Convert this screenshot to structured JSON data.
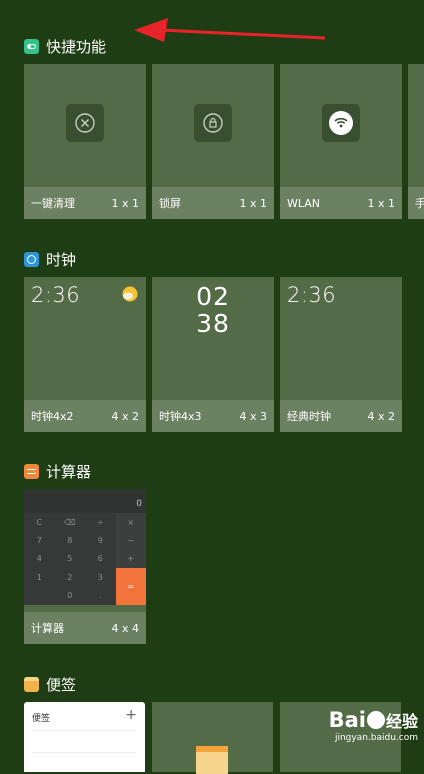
{
  "sections": {
    "quick": {
      "title": "快捷功能",
      "icon": "toggle-icon",
      "color": "#35c289"
    },
    "clock": {
      "title": "时钟",
      "icon": "clock-icon",
      "color": "#2f95d6"
    },
    "calculator": {
      "title": "计算器",
      "icon": "calculator-icon",
      "color": "#f08a3a"
    },
    "notes": {
      "title": "便签",
      "icon": "notes-icon",
      "color": "#f3b24a"
    }
  },
  "quick_tiles": [
    {
      "label": "一键清理",
      "size": "1 x 1",
      "icon": "close-circle-icon"
    },
    {
      "label": "锁屏",
      "size": "1 x 1",
      "icon": "lock-icon"
    },
    {
      "label": "WLAN",
      "size": "1 x 1",
      "icon": "wifi-icon"
    },
    {
      "label": "手",
      "size": "",
      "icon": ""
    }
  ],
  "clock_tiles": [
    {
      "label": "时钟4x2",
      "size": "4 x 2",
      "time": "2:36",
      "icon": "weather-sun-cloud-icon"
    },
    {
      "label": "时钟4x3",
      "size": "4 x 3",
      "hour": "02",
      "minute": "38"
    },
    {
      "label": "经典时钟",
      "size": "4 x 2",
      "time": "2:36"
    }
  ],
  "calculator_tile": {
    "label": "计算器",
    "size": "4 x 4",
    "display": "0",
    "keys": [
      "C",
      "⌫",
      "÷",
      "×",
      "7",
      "8",
      "9",
      "−",
      "4",
      "5",
      "6",
      "+",
      "1",
      "2",
      "3",
      "",
      "",
      "0",
      ".",
      ""
    ],
    "equals": "="
  },
  "notes_tile": {
    "title": "便签",
    "plus": "+"
  },
  "annotation": {
    "color": "#e8232a"
  },
  "watermark": {
    "brand": "Bai",
    "brand2": "经验",
    "url": "jingyan.baidu.com"
  }
}
